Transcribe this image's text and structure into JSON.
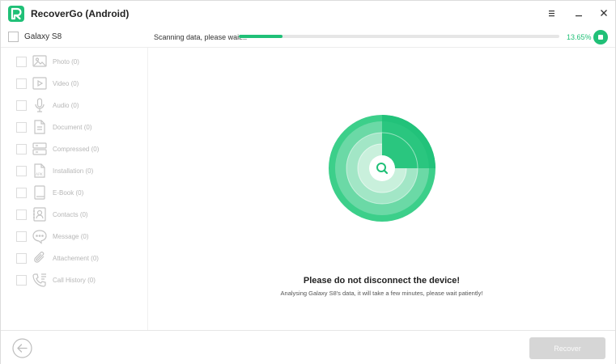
{
  "app": {
    "title": "RecoverGo (Android)",
    "accent_color": "#20c077"
  },
  "window_controls": [
    "menu-icon",
    "minimize-icon",
    "close-icon"
  ],
  "device_bar": {
    "device_name": "Galaxy S8",
    "status_text": "Scanning data, please wait...",
    "progress_percent": 13.65,
    "progress_label": "13.65%",
    "stop_icon": "stop-icon"
  },
  "sidebar": {
    "items": [
      {
        "label": "Photo",
        "count": "(0)",
        "icon": "photo-icon"
      },
      {
        "label": "Video",
        "count": "(0)",
        "icon": "video-icon"
      },
      {
        "label": "Audio",
        "count": "(0)",
        "icon": "microphone-icon"
      },
      {
        "label": "Document",
        "count": "(0)",
        "icon": "document-icon"
      },
      {
        "label": "Compressed",
        "count": "(0)",
        "icon": "archive-icon"
      },
      {
        "label": "Installation",
        "count": "(0)",
        "icon": "apk-icon"
      },
      {
        "label": "E-Book",
        "count": "(0)",
        "icon": "ebook-icon"
      },
      {
        "label": "Contacts",
        "count": "(0)",
        "icon": "contacts-icon"
      },
      {
        "label": "Message",
        "count": "(0)",
        "icon": "message-icon"
      },
      {
        "label": "Attachement",
        "count": "(0)",
        "icon": "attachment-icon"
      },
      {
        "label": "Call History",
        "count": "(0)",
        "icon": "call-history-icon"
      }
    ]
  },
  "main": {
    "title": "Please do not disconnect the device!",
    "subtitle": "Analysing Galaxy S8's data, it will take a few minutes, please wait patiently!"
  },
  "footer": {
    "back_icon": "back-arrow-icon",
    "recover_label": "Recover"
  }
}
